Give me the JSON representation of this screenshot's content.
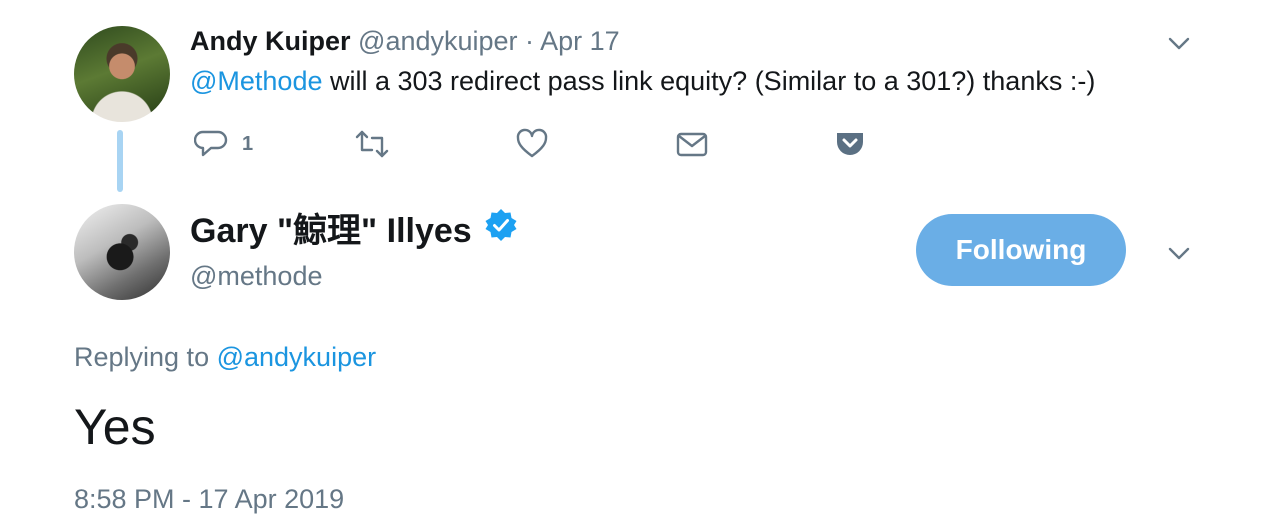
{
  "parent_tweet": {
    "display_name": "Andy Kuiper",
    "handle": "@andykuiper",
    "separator": "·",
    "date": "Apr 17",
    "mention": "@Methode",
    "text": " will a 303 redirect pass link equity? (Similar to a 301?) thanks :-)",
    "reply_count": "1",
    "icons": [
      "reply-icon",
      "retweet-icon",
      "like-icon",
      "direct-message-icon",
      "pocket-icon",
      "chevron-down-icon"
    ]
  },
  "main_tweet": {
    "display_name": "Gary \"鯨理\" Illyes",
    "handle": "@methode",
    "follow_label": "Following",
    "replying_prefix": "Replying to ",
    "replying_to": "@andykuiper",
    "text": "Yes",
    "timestamp": "8:58 PM - 17 Apr 2019",
    "icons": [
      "verified-badge-icon",
      "chevron-down-icon"
    ]
  },
  "colors": {
    "link": "#1b95e0",
    "secondary_text": "#657786",
    "primary_text": "#14171a",
    "follow_button": "#6aaee6",
    "thread_line": "#a8d4f3",
    "verified": "#1da1f2",
    "pocket": "#5b7083"
  }
}
